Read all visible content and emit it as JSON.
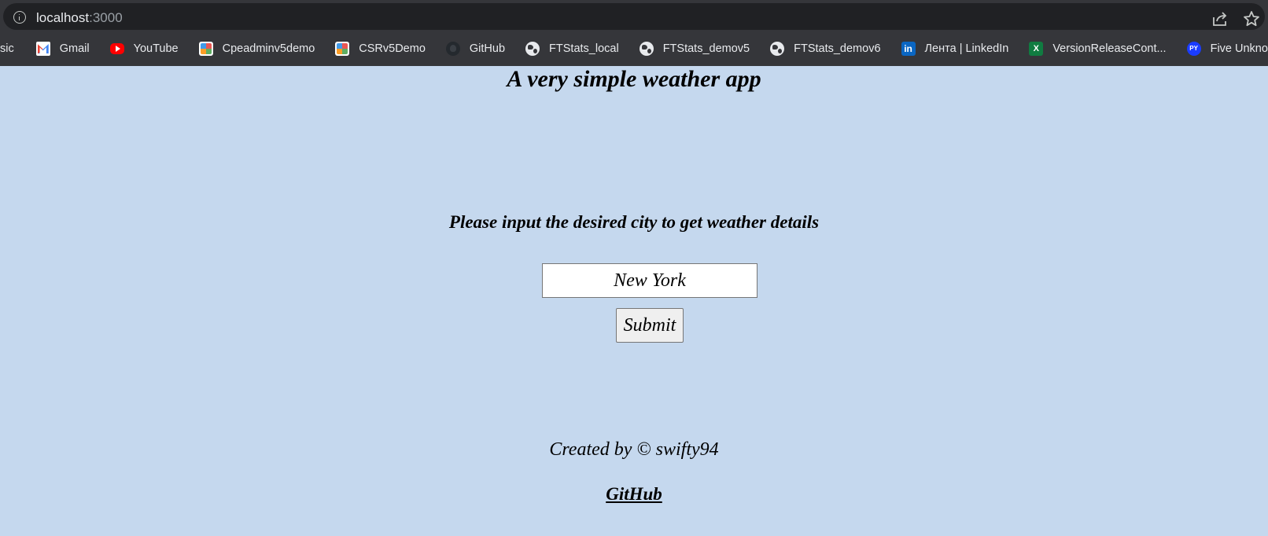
{
  "browser": {
    "url_host": "localhost",
    "url_port": ":3000",
    "bookmarks": [
      {
        "label": "sic",
        "icon": "none"
      },
      {
        "label": "Gmail",
        "icon": "gmail-icon"
      },
      {
        "label": "YouTube",
        "icon": "youtube-icon"
      },
      {
        "label": "Cpeadminv5demo",
        "icon": "app-icon"
      },
      {
        "label": "CSRv5Demo",
        "icon": "app-icon"
      },
      {
        "label": "GitHub",
        "icon": "github-icon"
      },
      {
        "label": "FTStats_local",
        "icon": "globe-icon"
      },
      {
        "label": "FTStats_demov5",
        "icon": "globe-icon"
      },
      {
        "label": "FTStats_demov6",
        "icon": "globe-icon"
      },
      {
        "label": "Лента | LinkedIn",
        "icon": "linkedin-icon"
      },
      {
        "label": "VersionReleaseCont...",
        "icon": "excel-icon"
      },
      {
        "label": "Five Unknown Trick...",
        "icon": "python-icon"
      }
    ]
  },
  "page": {
    "title": "A very simple weather app",
    "prompt": "Please input the desired city to get weather details",
    "city_input_value": "New York",
    "submit_label": "Submit",
    "credit": "Created by © swifty94",
    "github_link": "GitHub"
  },
  "colors": {
    "page_background": "#c5d8ee",
    "chrome_background": "#35363a",
    "address_bar": "#202124"
  }
}
